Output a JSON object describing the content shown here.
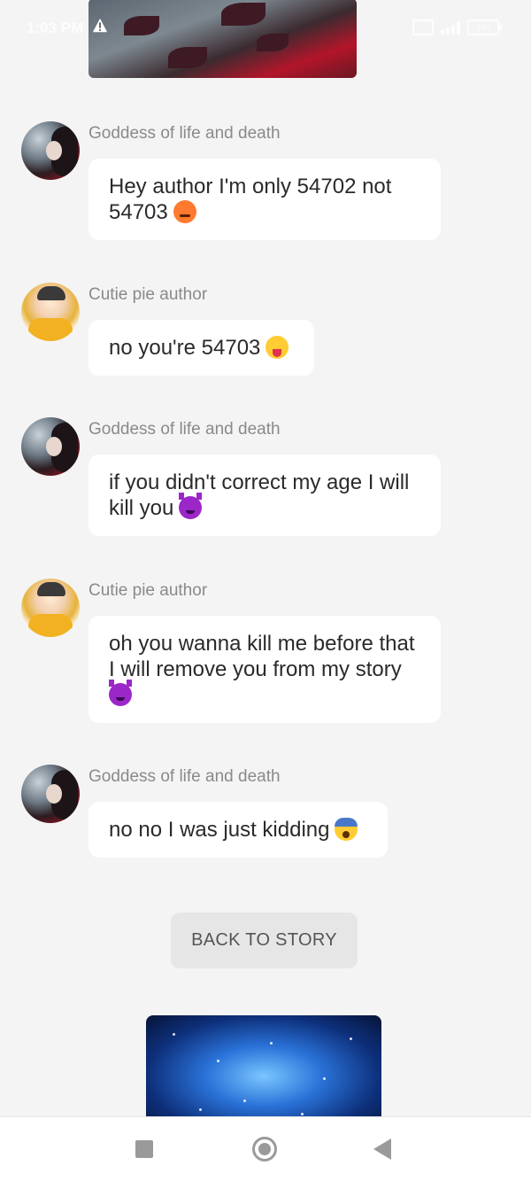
{
  "status_bar": {
    "time": "1:03 PM",
    "battery": "100"
  },
  "messages": [
    {
      "author": "Goddess of life and death",
      "text": "Hey author I'm only 54702 not 54703",
      "emoji": "angry-face-emoji"
    },
    {
      "author": "Cutie pie author",
      "text": "no you're 54703",
      "emoji": "tongue-out-emoji"
    },
    {
      "author": "Goddess of life and death",
      "text": "if you didn't correct my age I will kill you",
      "emoji": "smiling-devil-emoji"
    },
    {
      "author": "Cutie pie author",
      "text": "oh you wanna kill me before that I will remove you from my story",
      "emoji": "smiling-devil-emoji"
    },
    {
      "author": "Goddess of life and death",
      "text": "no no I was just kidding",
      "emoji": "fearful-face-emoji"
    }
  ],
  "back_button": {
    "label": "BACK TO STORY"
  },
  "colors": {
    "background": "#f4f4f4",
    "bubble": "#ffffff",
    "author_name": "#8a8a8a",
    "button": "#e6e6e6"
  },
  "icons": {
    "nav_recent": "square-icon",
    "nav_home": "circle-home-icon",
    "nav_back": "triangle-back-icon",
    "status_alert": "warning-icon"
  }
}
